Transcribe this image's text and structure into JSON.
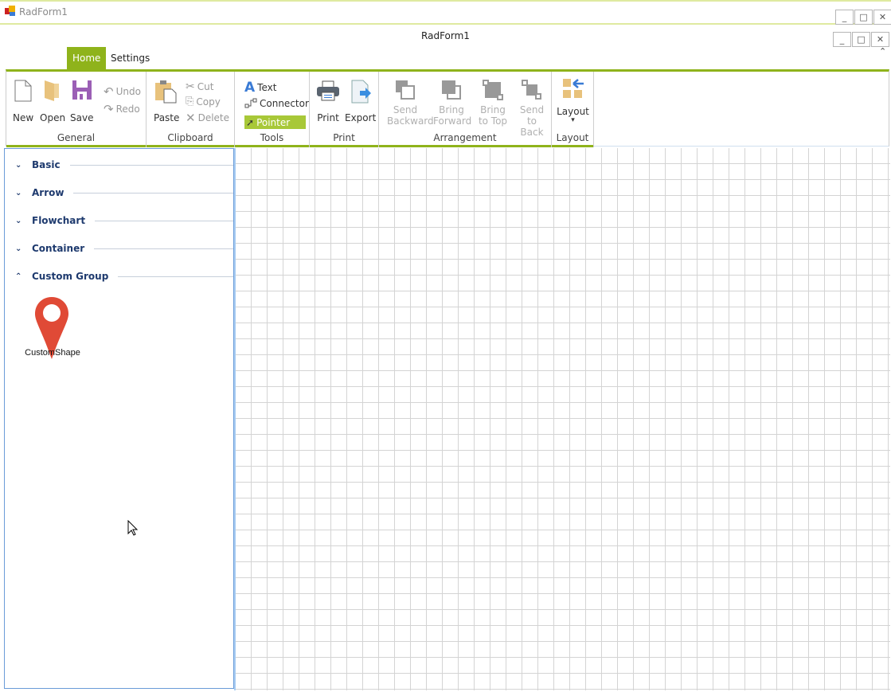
{
  "window": {
    "title": "RadForm1",
    "form_title": "RadForm1",
    "minimize": "_",
    "maximize": "□",
    "close": "✕",
    "collapse": "⌃"
  },
  "tabs": [
    {
      "label": "Home"
    },
    {
      "label": "Settings"
    }
  ],
  "ribbon": {
    "general": {
      "label": "General",
      "new": "New",
      "open": "Open",
      "save": "Save",
      "undo": "Undo",
      "redo": "Redo"
    },
    "clipboard": {
      "label": "Clipboard",
      "paste": "Paste",
      "cut": "Cut",
      "copy": "Copy",
      "delete": "Delete"
    },
    "tools": {
      "label": "Tools",
      "text": "Text",
      "connector": "Connector",
      "pointer": "Pointer"
    },
    "print": {
      "label": "Print",
      "print": "Print",
      "export": "Export"
    },
    "arrangement": {
      "label": "Arrangement",
      "send_backward": [
        "Send",
        "Backward"
      ],
      "bring_forward": [
        "Bring",
        "Forward"
      ],
      "bring_to_top": [
        "Bring",
        "to Top"
      ],
      "send_to_back": [
        "Send",
        "to Back"
      ]
    },
    "layout": {
      "label": "Layout",
      "layout": "Layout",
      "arrow": "▾"
    }
  },
  "toolbox": {
    "groups": [
      {
        "label": "Basic",
        "expanded": false
      },
      {
        "label": "Arrow",
        "expanded": false
      },
      {
        "label": "Flowchart",
        "expanded": false
      },
      {
        "label": "Container",
        "expanded": false
      },
      {
        "label": "Custom Group",
        "expanded": true
      }
    ],
    "items": [
      {
        "label": "CustomShape",
        "icon": "map-pin-icon"
      }
    ]
  },
  "colors": {
    "accent": "#8fb31b",
    "pin": "#e04a36"
  }
}
